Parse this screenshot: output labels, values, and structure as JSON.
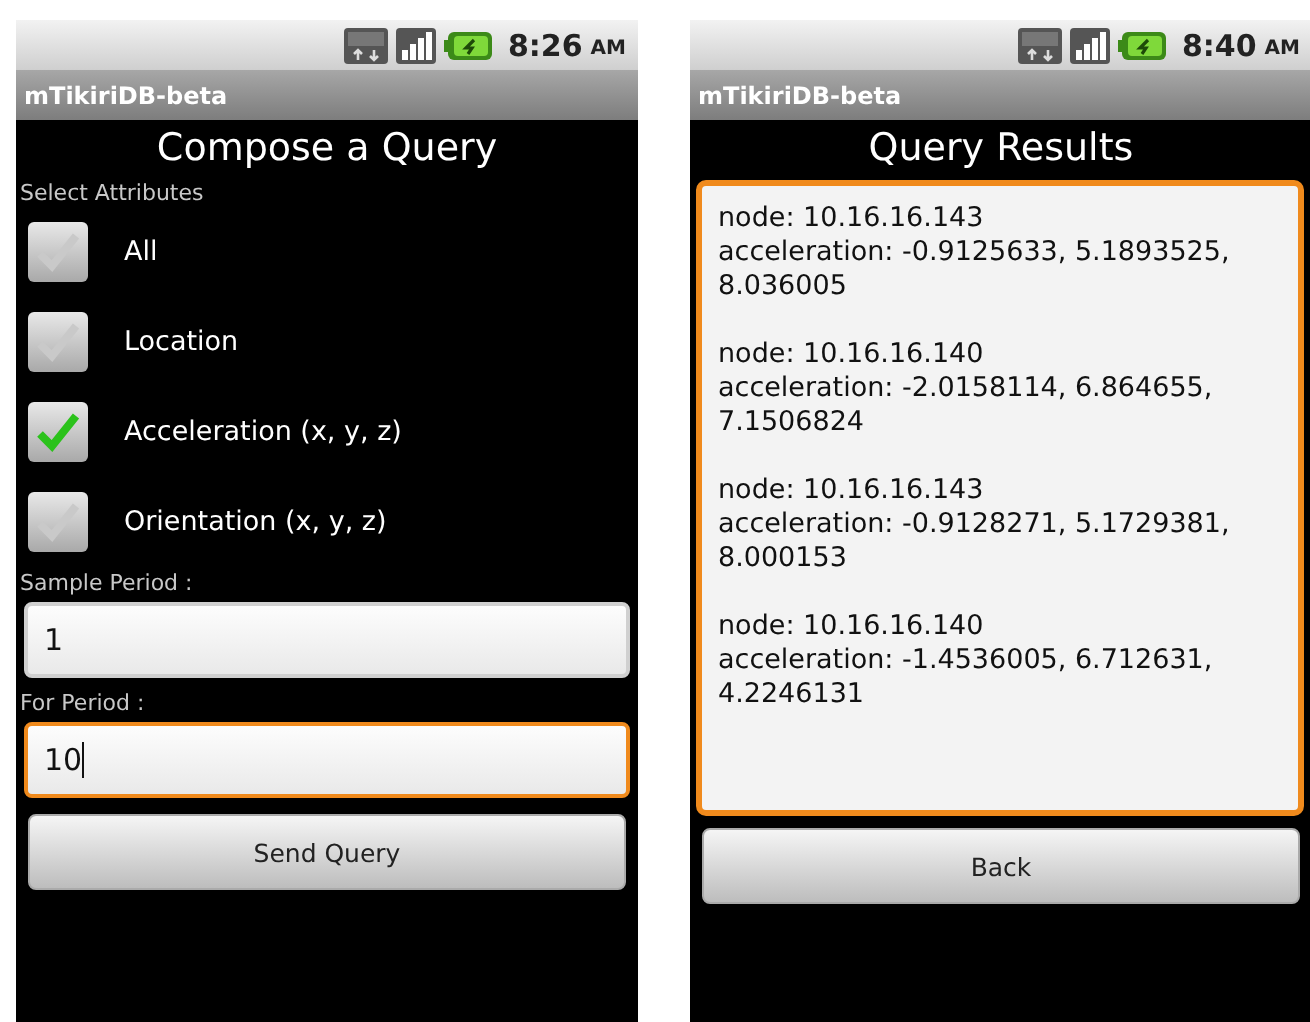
{
  "screens": [
    {
      "status_bar": {
        "time": "8:26",
        "meridiem": "AM"
      },
      "app_title": "mTikiriDB-beta",
      "heading": "Compose a Query",
      "kind": "compose",
      "section_label": "Select Attributes",
      "attributes": [
        {
          "label": "All",
          "checked": false
        },
        {
          "label": "Location",
          "checked": false
        },
        {
          "label": "Acceleration (x, y, z)",
          "checked": true
        },
        {
          "label": "Orientation (x, y, z)",
          "checked": false
        }
      ],
      "fields": [
        {
          "label": "Sample Period :",
          "value": "1",
          "focused": false
        },
        {
          "label": "For Period :",
          "value": "10",
          "focused": true
        }
      ],
      "button": "Send Query"
    },
    {
      "status_bar": {
        "time": "8:40",
        "meridiem": "AM"
      },
      "app_title": "mTikiriDB-beta",
      "heading": "Query Results",
      "kind": "results",
      "results_focused": true,
      "results": [
        {
          "node": "node: 10.16.16.143",
          "acceleration": "acceleration: -0.9125633, 5.1893525, 8.036005"
        },
        {
          "node": "node: 10.16.16.140",
          "acceleration": "acceleration: -2.0158114, 6.864655, 7.1506824"
        },
        {
          "node": "node: 10.16.16.143",
          "acceleration": "acceleration: -0.9128271, 5.1729381, 8.000153"
        },
        {
          "node": "node: 10.16.16.140",
          "acceleration": "acceleration: -1.4536005, 6.712631, 4.2246131"
        }
      ],
      "button": "Back"
    }
  ]
}
